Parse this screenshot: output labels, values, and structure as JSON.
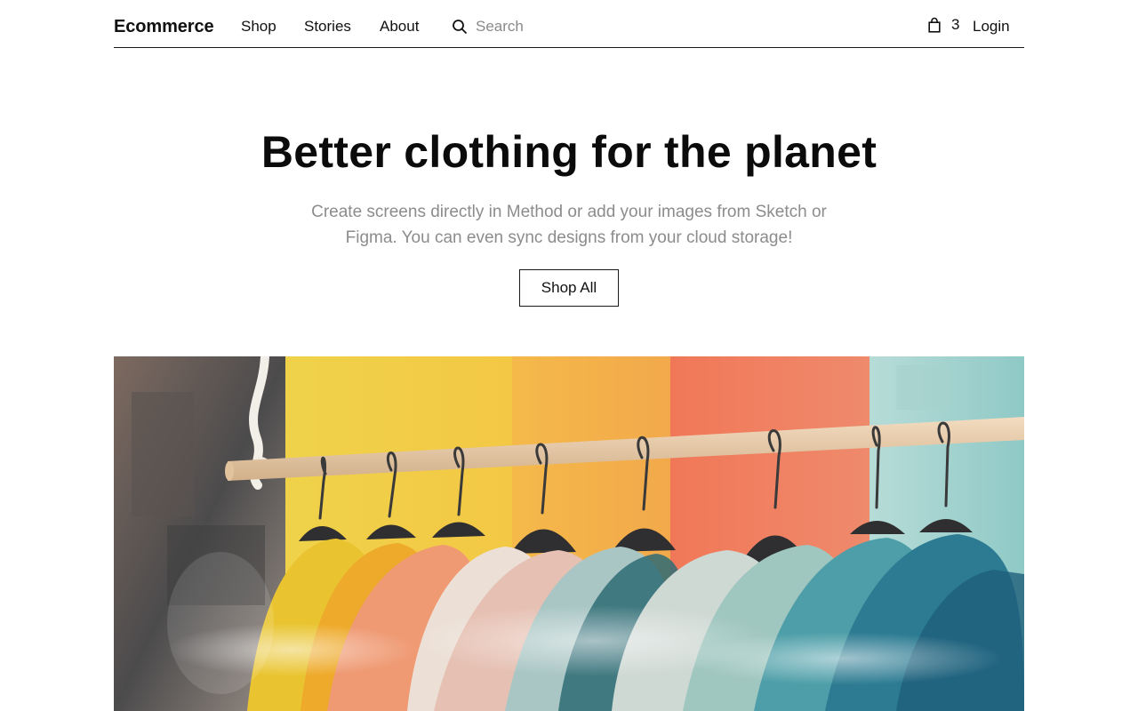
{
  "nav": {
    "brand": "Ecommerce",
    "links": [
      {
        "label": "Shop"
      },
      {
        "label": "Stories"
      },
      {
        "label": "About"
      }
    ],
    "search": {
      "placeholder": "Search",
      "icon": "search-icon"
    },
    "cart": {
      "icon": "shopping-bag-icon",
      "count": "3"
    },
    "login": "Login"
  },
  "hero": {
    "title": "Better clothing for the planet",
    "subtitle": "Create screens directly in Method or add your images from Sketch or Figma. You can even sync designs from your cloud storage!",
    "cta": "Shop All"
  },
  "colors": {
    "text": "#111111",
    "muted": "#8c8c8c",
    "border": "#1a1a1a",
    "background": "#ffffff"
  }
}
